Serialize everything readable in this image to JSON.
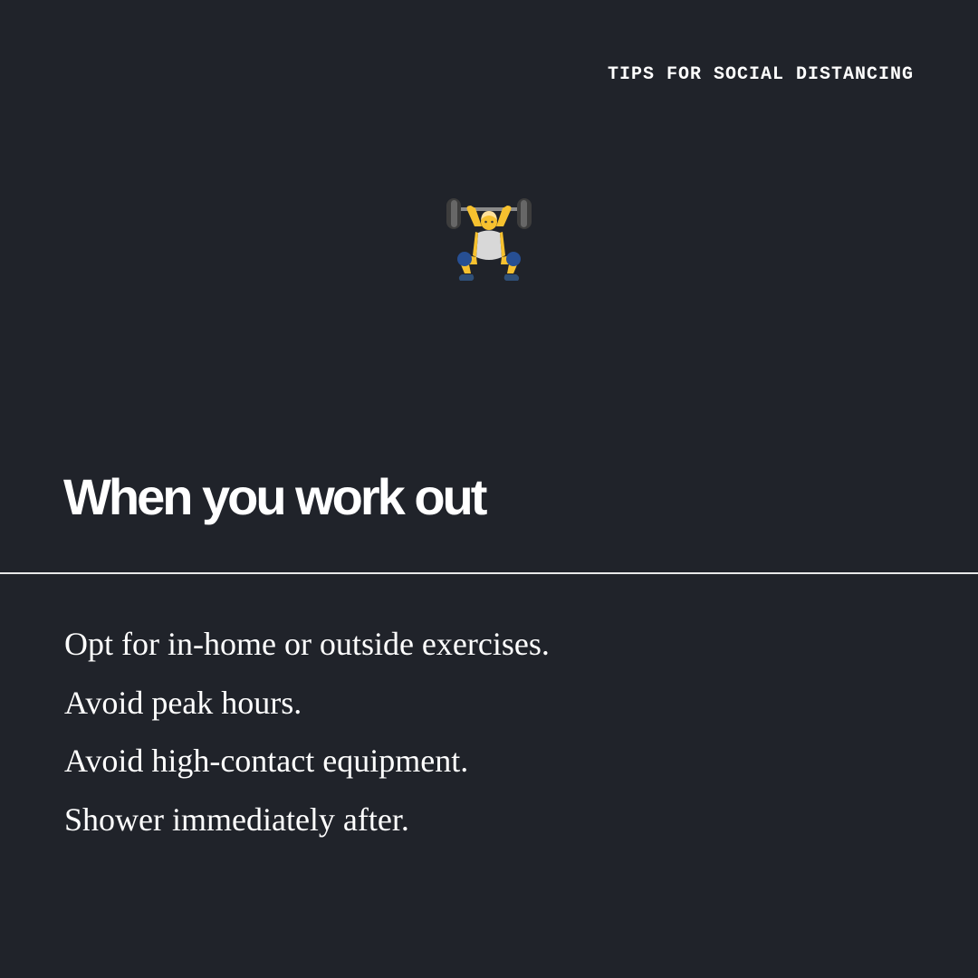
{
  "header": {
    "kicker": "TIPS FOR SOCIAL DISTANCING"
  },
  "hero": {
    "icon": "person-lifting-weights-icon"
  },
  "section": {
    "title": "When you work out"
  },
  "tips": [
    "Opt for in-home or outside exercises.",
    "Avoid peak hours.",
    "Avoid high-contact equipment.",
    "Shower immediately after."
  ],
  "colors": {
    "background": "#20232a",
    "text": "#ffffff",
    "divider": "#e9e9e9",
    "accent_yellow": "#f6c12f",
    "accent_blue": "#274f93"
  }
}
